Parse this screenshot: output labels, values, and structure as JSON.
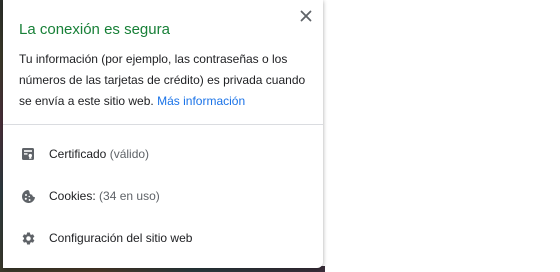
{
  "popup": {
    "title": "La conexión es segura",
    "title_color": "#188038",
    "close_icon": "close-icon",
    "description_lines": [
      "Tu información (por ejemplo, las contraseñas o los",
      "números de las tarjetas de crédito) es privada cuando",
      "se envía a este sitio web."
    ],
    "more_info_label": "Más información",
    "link_color": "#1a73e8"
  },
  "items": [
    {
      "icon": "certificate-icon",
      "label": "Certificado",
      "sub": "(válido)"
    },
    {
      "icon": "cookie-icon",
      "label": "Cookies:",
      "sub": "(34 en uso)"
    },
    {
      "icon": "gear-icon",
      "label": "Configuración del sitio web",
      "sub": ""
    }
  ]
}
